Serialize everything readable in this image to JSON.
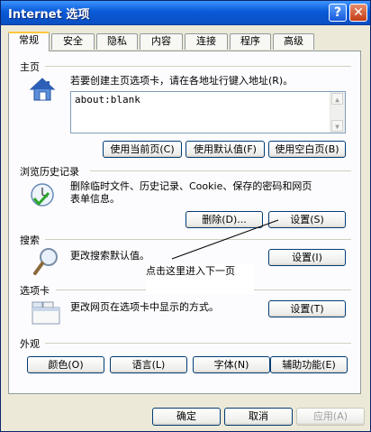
{
  "window": {
    "title": "Internet 选项",
    "help_glyph": "?",
    "close_glyph": "✕"
  },
  "tabs": [
    {
      "label": "常规",
      "active": true
    },
    {
      "label": "安全"
    },
    {
      "label": "隐私"
    },
    {
      "label": "内容"
    },
    {
      "label": "连接"
    },
    {
      "label": "程序"
    },
    {
      "label": "高级"
    }
  ],
  "homepage": {
    "title": "主页",
    "description": "若要创建主页选项卡，请在各地址行键入地址(R)。",
    "value": "about:blank",
    "buttons": {
      "use_current": "使用当前页(C)",
      "use_default": "使用默认值(F)",
      "use_blank": "使用空白页(B)"
    }
  },
  "history": {
    "title": "浏览历史记录",
    "description_line1": "删除临时文件、历史记录、Cookie、保存的密码和网页",
    "description_line2": "表单信息。",
    "buttons": {
      "delete": "删除(D)...",
      "settings": "设置(S)"
    }
  },
  "search": {
    "title": "搜索",
    "description": "更改搜索默认值。",
    "buttons": {
      "settings": "设置(I)"
    }
  },
  "tabsgroup": {
    "title": "选项卡",
    "description": "更改网页在选项卡中显示的方式。",
    "buttons": {
      "settings": "设置(T)"
    }
  },
  "appearance": {
    "title": "外观",
    "buttons": {
      "colors": "颜色(O)",
      "languages": "语言(L)",
      "fonts": "字体(N)",
      "accessibility": "辅助功能(E)"
    }
  },
  "annotation": {
    "text": "点击这里进入下一页"
  },
  "footer": {
    "ok": "确定",
    "cancel": "取消",
    "apply": "应用(A)"
  }
}
